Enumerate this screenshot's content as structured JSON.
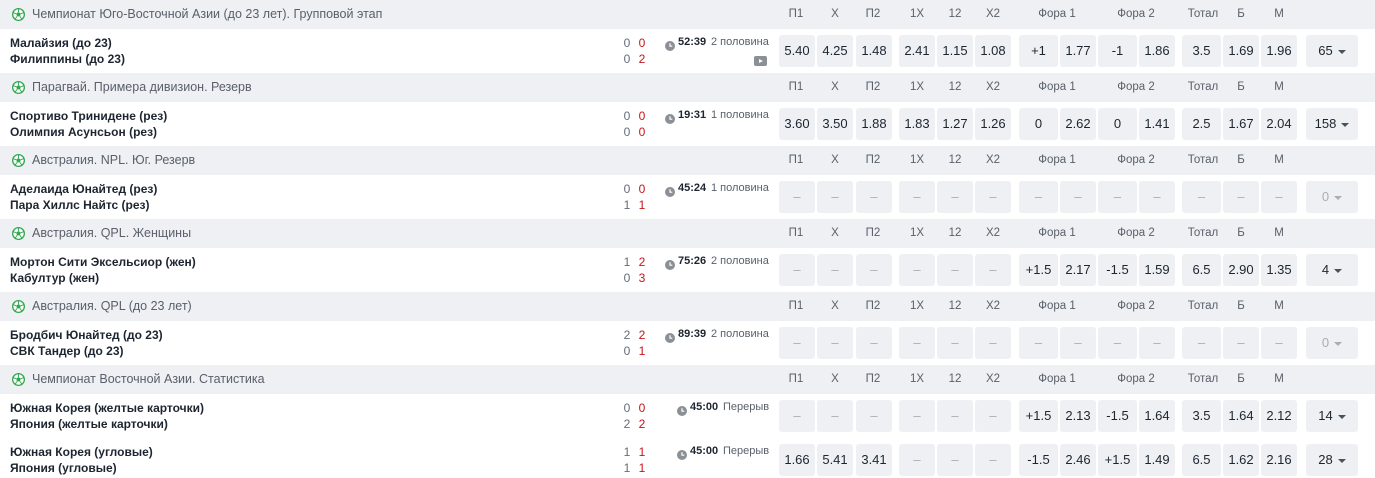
{
  "columns": [
    "П1",
    "Х",
    "П2",
    "1Х",
    "12",
    "Х2",
    "Фора 1",
    "Фора 2",
    "Тотал",
    "Б",
    "М"
  ],
  "icons": {
    "league": "soccer-ball-icon",
    "clock": "clock-icon",
    "video": "video-play-icon",
    "more": "chevron-down-icon"
  },
  "colors": {
    "header_bg": "#eef0f3",
    "cell_bg": "#eef0f3",
    "accent_green": "#2fa84f",
    "score_red": "#c4161c"
  },
  "blocks": [
    {
      "league": "Чемпионат Юго-Восточной Азии (до 23 лет). Групповой этап",
      "matches": [
        {
          "team1": "Малайзия (до 23)",
          "team2": "Филиппины (до 23)",
          "score1_sets": "0",
          "score1_cur": "0",
          "score2_sets": "0",
          "score2_cur": "2",
          "time": "52:39",
          "phase": "2 половина",
          "video": true,
          "odds": [
            "5.40",
            "4.25",
            "1.48",
            "2.41",
            "1.15",
            "1.08",
            "+1",
            "1.77",
            "-1",
            "1.86",
            "3.5",
            "1.69",
            "1.96"
          ],
          "more": "65"
        }
      ]
    },
    {
      "league": "Парагвай. Примера дивизион. Резерв",
      "matches": [
        {
          "team1": "Спортиво Тринидене (рез)",
          "team2": "Олимпия Асунсьон (рез)",
          "score1_sets": "0",
          "score1_cur": "0",
          "score2_sets": "0",
          "score2_cur": "0",
          "time": "19:31",
          "phase": "1 половина",
          "video": false,
          "odds": [
            "3.60",
            "3.50",
            "1.88",
            "1.83",
            "1.27",
            "1.26",
            "0",
            "2.62",
            "0",
            "1.41",
            "2.5",
            "1.67",
            "2.04"
          ],
          "more": "158"
        }
      ]
    },
    {
      "league": "Австралия. NPL. Юг. Резерв",
      "matches": [
        {
          "team1": "Аделаида Юнайтед (рез)",
          "team2": "Пара Хиллс Найтс (рез)",
          "score1_sets": "0",
          "score1_cur": "0",
          "score2_sets": "1",
          "score2_cur": "1",
          "time": "45:24",
          "phase": "1 половина",
          "video": false,
          "odds": [
            "–",
            "–",
            "–",
            "–",
            "–",
            "–",
            "–",
            "–",
            "–",
            "–",
            "–",
            "–",
            "–"
          ],
          "more": "0"
        }
      ]
    },
    {
      "league": "Австралия. QPL. Женщины",
      "matches": [
        {
          "team1": "Мортон Сити Эксельсиор (жен)",
          "team2": "Кабултур (жен)",
          "score1_sets": "1",
          "score1_cur": "2",
          "score2_sets": "0",
          "score2_cur": "3",
          "time": "75:26",
          "phase": "2 половина",
          "video": false,
          "odds": [
            "–",
            "–",
            "–",
            "–",
            "–",
            "–",
            "+1.5",
            "2.17",
            "-1.5",
            "1.59",
            "6.5",
            "2.90",
            "1.35"
          ],
          "more": "4"
        }
      ]
    },
    {
      "league": "Австралия. QPL (до 23 лет)",
      "matches": [
        {
          "team1": "Бродбич Юнайтед (до 23)",
          "team2": "СВК Тандер (до 23)",
          "score1_sets": "2",
          "score1_cur": "2",
          "score2_sets": "0",
          "score2_cur": "1",
          "time": "89:39",
          "phase": "2 половина",
          "video": false,
          "odds": [
            "–",
            "–",
            "–",
            "–",
            "–",
            "–",
            "–",
            "–",
            "–",
            "–",
            "–",
            "–",
            "–"
          ],
          "more": "0"
        }
      ]
    },
    {
      "league": "Чемпионат Восточной Азии. Статистика",
      "matches": [
        {
          "team1": "Южная Корея (желтые карточки)",
          "team2": "Япония (желтые карточки)",
          "score1_sets": "0",
          "score1_cur": "0",
          "score2_sets": "2",
          "score2_cur": "2",
          "time": "45:00",
          "phase": "Перерыв",
          "video": false,
          "odds": [
            "–",
            "–",
            "–",
            "–",
            "–",
            "–",
            "+1.5",
            "2.13",
            "-1.5",
            "1.64",
            "3.5",
            "1.64",
            "2.12"
          ],
          "more": "14"
        },
        {
          "team1": "Южная Корея (угловые)",
          "team2": "Япония (угловые)",
          "score1_sets": "1",
          "score1_cur": "1",
          "score2_sets": "1",
          "score2_cur": "1",
          "time": "45:00",
          "phase": "Перерыв",
          "video": false,
          "odds": [
            "1.66",
            "5.41",
            "3.41",
            "–",
            "–",
            "–",
            "-1.5",
            "2.46",
            "+1.5",
            "1.49",
            "6.5",
            "1.62",
            "2.16"
          ],
          "more": "28"
        }
      ]
    }
  ]
}
